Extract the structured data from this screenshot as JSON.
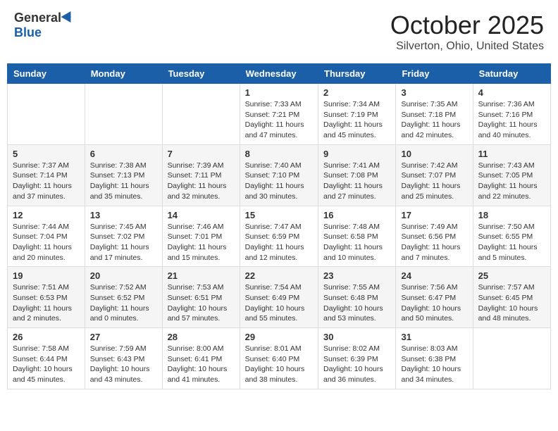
{
  "logo": {
    "general": "General",
    "blue": "Blue"
  },
  "header": {
    "month": "October 2025",
    "location": "Silverton, Ohio, United States"
  },
  "weekdays": [
    "Sunday",
    "Monday",
    "Tuesday",
    "Wednesday",
    "Thursday",
    "Friday",
    "Saturday"
  ],
  "weeks": [
    [
      {
        "day": "",
        "info": ""
      },
      {
        "day": "",
        "info": ""
      },
      {
        "day": "",
        "info": ""
      },
      {
        "day": "1",
        "info": "Sunrise: 7:33 AM\nSunset: 7:21 PM\nDaylight: 11 hours\nand 47 minutes."
      },
      {
        "day": "2",
        "info": "Sunrise: 7:34 AM\nSunset: 7:19 PM\nDaylight: 11 hours\nand 45 minutes."
      },
      {
        "day": "3",
        "info": "Sunrise: 7:35 AM\nSunset: 7:18 PM\nDaylight: 11 hours\nand 42 minutes."
      },
      {
        "day": "4",
        "info": "Sunrise: 7:36 AM\nSunset: 7:16 PM\nDaylight: 11 hours\nand 40 minutes."
      }
    ],
    [
      {
        "day": "5",
        "info": "Sunrise: 7:37 AM\nSunset: 7:14 PM\nDaylight: 11 hours\nand 37 minutes."
      },
      {
        "day": "6",
        "info": "Sunrise: 7:38 AM\nSunset: 7:13 PM\nDaylight: 11 hours\nand 35 minutes."
      },
      {
        "day": "7",
        "info": "Sunrise: 7:39 AM\nSunset: 7:11 PM\nDaylight: 11 hours\nand 32 minutes."
      },
      {
        "day": "8",
        "info": "Sunrise: 7:40 AM\nSunset: 7:10 PM\nDaylight: 11 hours\nand 30 minutes."
      },
      {
        "day": "9",
        "info": "Sunrise: 7:41 AM\nSunset: 7:08 PM\nDaylight: 11 hours\nand 27 minutes."
      },
      {
        "day": "10",
        "info": "Sunrise: 7:42 AM\nSunset: 7:07 PM\nDaylight: 11 hours\nand 25 minutes."
      },
      {
        "day": "11",
        "info": "Sunrise: 7:43 AM\nSunset: 7:05 PM\nDaylight: 11 hours\nand 22 minutes."
      }
    ],
    [
      {
        "day": "12",
        "info": "Sunrise: 7:44 AM\nSunset: 7:04 PM\nDaylight: 11 hours\nand 20 minutes."
      },
      {
        "day": "13",
        "info": "Sunrise: 7:45 AM\nSunset: 7:02 PM\nDaylight: 11 hours\nand 17 minutes."
      },
      {
        "day": "14",
        "info": "Sunrise: 7:46 AM\nSunset: 7:01 PM\nDaylight: 11 hours\nand 15 minutes."
      },
      {
        "day": "15",
        "info": "Sunrise: 7:47 AM\nSunset: 6:59 PM\nDaylight: 11 hours\nand 12 minutes."
      },
      {
        "day": "16",
        "info": "Sunrise: 7:48 AM\nSunset: 6:58 PM\nDaylight: 11 hours\nand 10 minutes."
      },
      {
        "day": "17",
        "info": "Sunrise: 7:49 AM\nSunset: 6:56 PM\nDaylight: 11 hours\nand 7 minutes."
      },
      {
        "day": "18",
        "info": "Sunrise: 7:50 AM\nSunset: 6:55 PM\nDaylight: 11 hours\nand 5 minutes."
      }
    ],
    [
      {
        "day": "19",
        "info": "Sunrise: 7:51 AM\nSunset: 6:53 PM\nDaylight: 11 hours\nand 2 minutes."
      },
      {
        "day": "20",
        "info": "Sunrise: 7:52 AM\nSunset: 6:52 PM\nDaylight: 11 hours\nand 0 minutes."
      },
      {
        "day": "21",
        "info": "Sunrise: 7:53 AM\nSunset: 6:51 PM\nDaylight: 10 hours\nand 57 minutes."
      },
      {
        "day": "22",
        "info": "Sunrise: 7:54 AM\nSunset: 6:49 PM\nDaylight: 10 hours\nand 55 minutes."
      },
      {
        "day": "23",
        "info": "Sunrise: 7:55 AM\nSunset: 6:48 PM\nDaylight: 10 hours\nand 53 minutes."
      },
      {
        "day": "24",
        "info": "Sunrise: 7:56 AM\nSunset: 6:47 PM\nDaylight: 10 hours\nand 50 minutes."
      },
      {
        "day": "25",
        "info": "Sunrise: 7:57 AM\nSunset: 6:45 PM\nDaylight: 10 hours\nand 48 minutes."
      }
    ],
    [
      {
        "day": "26",
        "info": "Sunrise: 7:58 AM\nSunset: 6:44 PM\nDaylight: 10 hours\nand 45 minutes."
      },
      {
        "day": "27",
        "info": "Sunrise: 7:59 AM\nSunset: 6:43 PM\nDaylight: 10 hours\nand 43 minutes."
      },
      {
        "day": "28",
        "info": "Sunrise: 8:00 AM\nSunset: 6:41 PM\nDaylight: 10 hours\nand 41 minutes."
      },
      {
        "day": "29",
        "info": "Sunrise: 8:01 AM\nSunset: 6:40 PM\nDaylight: 10 hours\nand 38 minutes."
      },
      {
        "day": "30",
        "info": "Sunrise: 8:02 AM\nSunset: 6:39 PM\nDaylight: 10 hours\nand 36 minutes."
      },
      {
        "day": "31",
        "info": "Sunrise: 8:03 AM\nSunset: 6:38 PM\nDaylight: 10 hours\nand 34 minutes."
      },
      {
        "day": "",
        "info": ""
      }
    ]
  ]
}
